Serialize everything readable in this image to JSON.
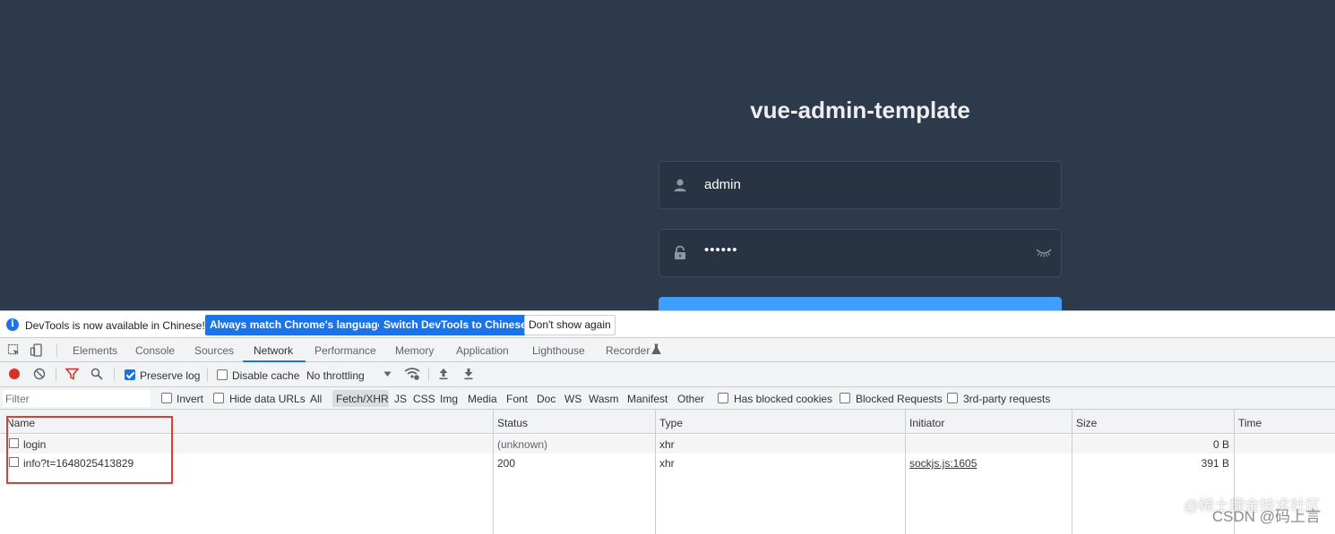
{
  "login": {
    "title": "vue-admin-template",
    "username_value": "admin",
    "password_value": "••••••"
  },
  "devtools": {
    "infobar": {
      "message": "DevTools is now available in Chinese!",
      "btn_match": "Always match Chrome's language",
      "btn_switch": "Switch DevTools to Chinese",
      "btn_dont_show": "Don't show again"
    },
    "tabs": [
      {
        "label": "Elements"
      },
      {
        "label": "Console"
      },
      {
        "label": "Sources"
      },
      {
        "label": "Network",
        "active": true
      },
      {
        "label": "Performance"
      },
      {
        "label": "Memory"
      },
      {
        "label": "Application"
      },
      {
        "label": "Lighthouse"
      },
      {
        "label": "Recorder"
      }
    ],
    "toolbar": {
      "preserve_log": "Preserve log",
      "preserve_log_checked": true,
      "disable_cache": "Disable cache",
      "throttling": "No throttling"
    },
    "filter": {
      "placeholder": "Filter",
      "invert": "Invert",
      "hide_data_urls": "Hide data URLs",
      "types": [
        "All",
        "Fetch/XHR",
        "JS",
        "CSS",
        "Img",
        "Media",
        "Font",
        "Doc",
        "WS",
        "Wasm",
        "Manifest",
        "Other"
      ],
      "selected_type": "Fetch/XHR",
      "has_blocked_cookies": "Has blocked cookies",
      "blocked_requests": "Blocked Requests",
      "third_party": "3rd-party requests"
    },
    "table": {
      "columns": [
        "Name",
        "Status",
        "Type",
        "Initiator",
        "Size",
        "Time"
      ],
      "rows": [
        {
          "name": "login",
          "status": "(unknown)",
          "type": "xhr",
          "initiator": "",
          "size": "0 B",
          "time": ""
        },
        {
          "name": "info?t=1648025413829",
          "status": "200",
          "type": "xhr",
          "initiator": "sockjs.js:1605",
          "size": "391 B",
          "time": ""
        }
      ]
    }
  },
  "watermark": {
    "line1": "@稀土掘金技术社区",
    "line2": "CSDN @码上言"
  },
  "colors": {
    "login_bg": "#2d3a4b",
    "accent": "#1a73e8",
    "login_button": "#409eff",
    "highlight": "#e53935"
  }
}
